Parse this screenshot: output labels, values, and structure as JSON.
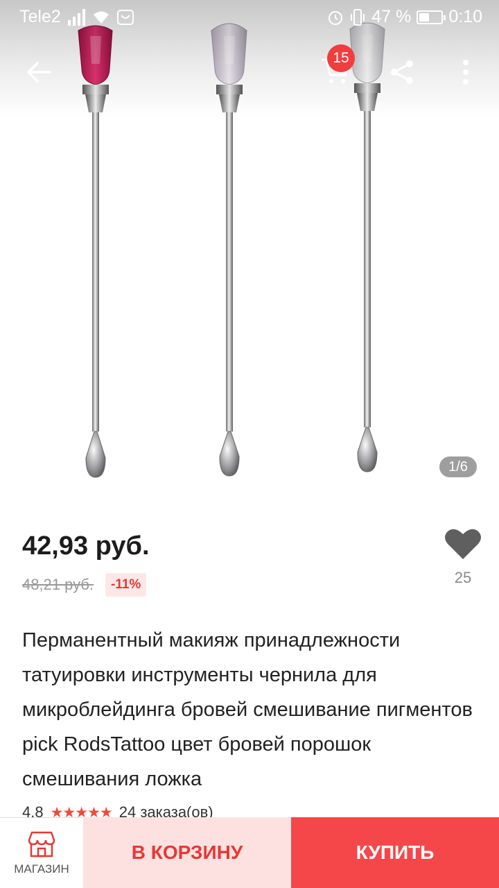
{
  "status_bar": {
    "carrier": "Tele2",
    "battery": "47 %",
    "battery_fraction": 0.47,
    "time": "0:10"
  },
  "toolbar": {
    "back_icon": "arrow-left-icon",
    "cart_icon": "shopping-cart-icon",
    "cart_count": "15",
    "share_icon": "share-icon",
    "more_icon": "more-vertical-icon"
  },
  "gallery": {
    "indicator": "1/6",
    "tip_colors": [
      "#d6245e",
      "#d9d2dc",
      "#e8e8ea"
    ]
  },
  "product": {
    "price": "42,93 руб.",
    "old_price": "48,21 руб.",
    "discount": "-11%",
    "favorites_count": "25",
    "title": "Перманентный макияж принадлежности татуировки инструменты чернила для микроблейдинга бровей смешивание пигментов pick RodsTattoo цвет бровей порошок смешивания ложка",
    "rating": "4.8",
    "stars": "★★★★★",
    "orders": "24 заказа(ов)"
  },
  "actions": {
    "shop_label": "МАГАЗИН",
    "add_to_cart": "В КОРЗИНУ",
    "buy": "КУПИТЬ"
  },
  "colors": {
    "accent": "#f5474a",
    "accent_light": "#fde1e1",
    "discount_text": "#e53935"
  }
}
